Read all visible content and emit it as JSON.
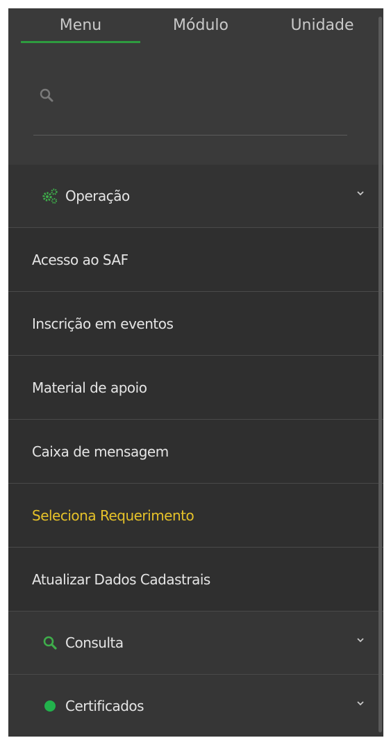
{
  "tabs": [
    {
      "label": "Menu",
      "active": true
    },
    {
      "label": "Módulo",
      "active": false
    },
    {
      "label": "Unidade",
      "active": false
    }
  ],
  "search": {
    "placeholder": ""
  },
  "sections": {
    "operacao": {
      "label": "Operação",
      "icon": "gears-icon",
      "expanded": true
    },
    "consulta": {
      "label": "Consulta",
      "icon": "search-icon",
      "expanded": false
    },
    "certificados": {
      "label": "Certificados",
      "icon": "green-dot-icon",
      "expanded": false
    }
  },
  "operacao_items": [
    {
      "label": "Acesso ao SAF"
    },
    {
      "label": "Inscrição em eventos"
    },
    {
      "label": "Material de apoio"
    },
    {
      "label": "Caixa de mensagem"
    },
    {
      "label": "Seleciona Requerimento",
      "highlight": true
    },
    {
      "label": "Atualizar Dados Cadastrais"
    }
  ],
  "colors": {
    "accent": "#2e9b3f",
    "highlight_text": "#e6c229",
    "panel_bg": "#3a3a3a"
  }
}
